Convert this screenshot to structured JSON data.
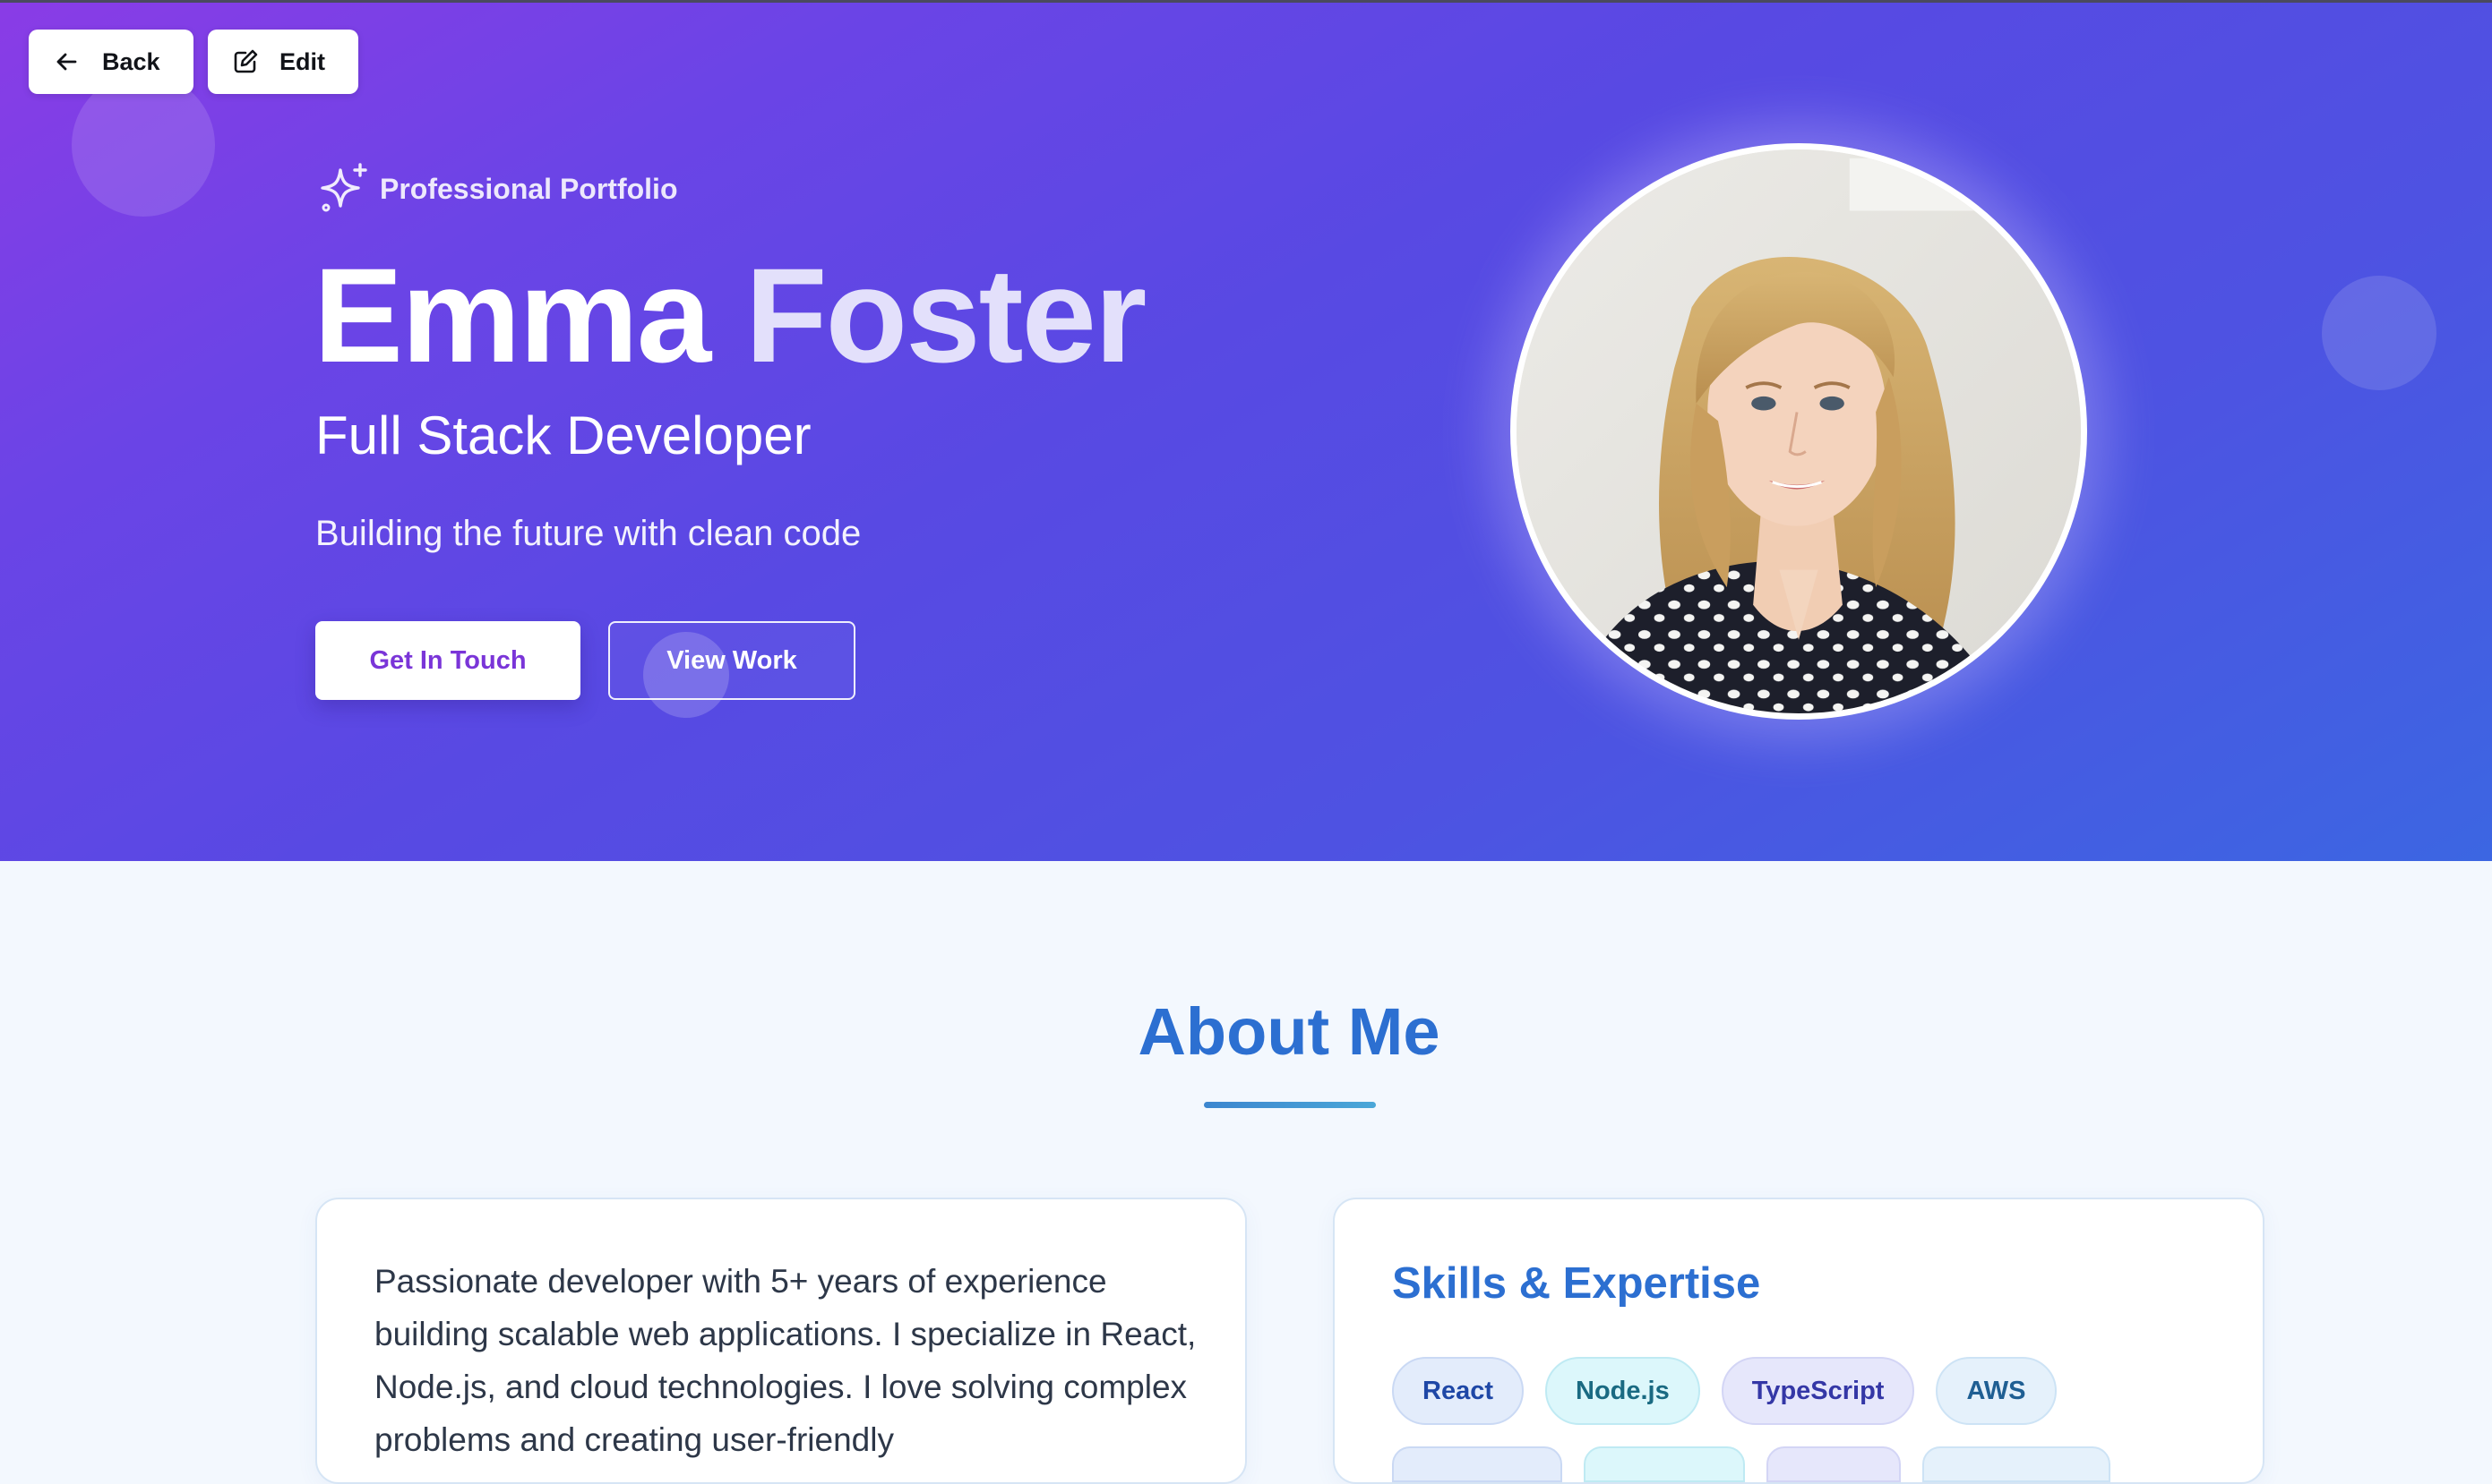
{
  "toolbar": {
    "back_label": "Back",
    "edit_label": "Edit"
  },
  "hero": {
    "tagline": "Professional Portfolio",
    "first_name": "Emma",
    "last_name": "Foster",
    "role": "Full Stack Developer",
    "subtitle": "Building the future with clean code",
    "primary_cta": "Get In Touch",
    "secondary_cta": "View Work",
    "colors": {
      "gradient_start": "#8a3ce6",
      "gradient_end": "#3c66e2",
      "cta_text": "#7a35d8"
    }
  },
  "about": {
    "title": "About Me",
    "bio": "Passionate developer with 5+ years of experience building scalable web applications. I specialize in React, Node.js, and cloud technologies. I love solving complex problems and creating user-friendly",
    "skills": {
      "title": "Skills & Expertise",
      "items": [
        "React",
        "Node.js",
        "TypeScript",
        "AWS"
      ]
    },
    "accent_color": "#2c6fd1"
  },
  "icons": {
    "back": "arrow-left-icon",
    "edit": "edit-icon",
    "tagline": "sparkles-icon"
  }
}
